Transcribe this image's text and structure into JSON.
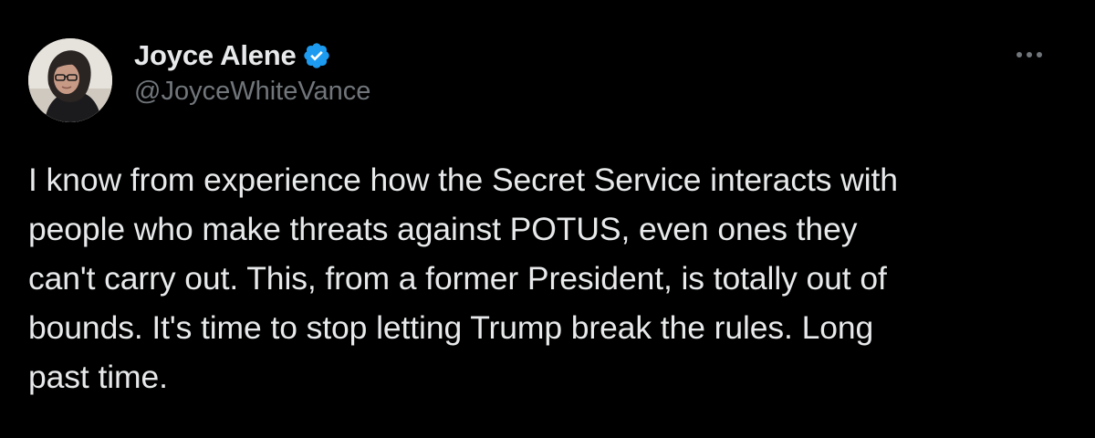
{
  "tweet": {
    "author": {
      "display_name": "Joyce Alene",
      "handle": "@JoyceWhiteVance",
      "verified": true,
      "avatar_icon": "profile-photo"
    },
    "text_lines": [
      "I know from experience how the Secret Service interacts with",
      "people who make threats against POTUS, even ones they",
      "can't carry out. This, from a former President, is totally out of",
      "bounds. It's time to stop letting Trump break the rules. Long",
      "past time."
    ],
    "more_icon": "more-horizontal-icon"
  },
  "colors": {
    "background": "#000000",
    "text_primary": "#e7e9ea",
    "text_secondary": "#71767b",
    "verified_badge": "#1d9bf0"
  }
}
